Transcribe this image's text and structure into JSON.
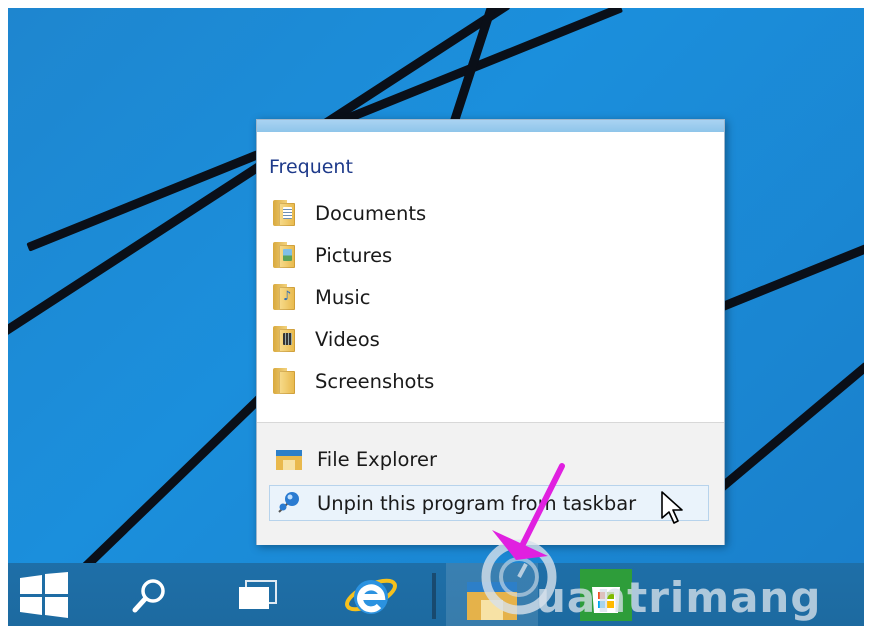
{
  "jump_list": {
    "heading": "Frequent",
    "items": [
      {
        "label": "Documents",
        "icon": "documents-folder-icon"
      },
      {
        "label": "Pictures",
        "icon": "pictures-folder-icon"
      },
      {
        "label": "Music",
        "icon": "music-folder-icon"
      },
      {
        "label": "Videos",
        "icon": "videos-folder-icon"
      },
      {
        "label": "Screenshots",
        "icon": "folder-icon"
      }
    ],
    "tasks": [
      {
        "label": "File Explorer",
        "icon": "file-explorer-icon"
      },
      {
        "label": "Unpin this program from taskbar",
        "icon": "unpin-icon"
      }
    ]
  },
  "taskbar": {
    "buttons": [
      "start-icon",
      "search-icon",
      "task-view-icon",
      "internet-explorer-icon",
      "file-explorer-icon",
      "store-icon"
    ]
  },
  "watermark": "uantrimang",
  "colors": {
    "desktop": "#1b8fdc",
    "taskbar": "#1e6fa8",
    "heading": "#1e3a8a",
    "annotation_arrow": "#e020e0"
  }
}
